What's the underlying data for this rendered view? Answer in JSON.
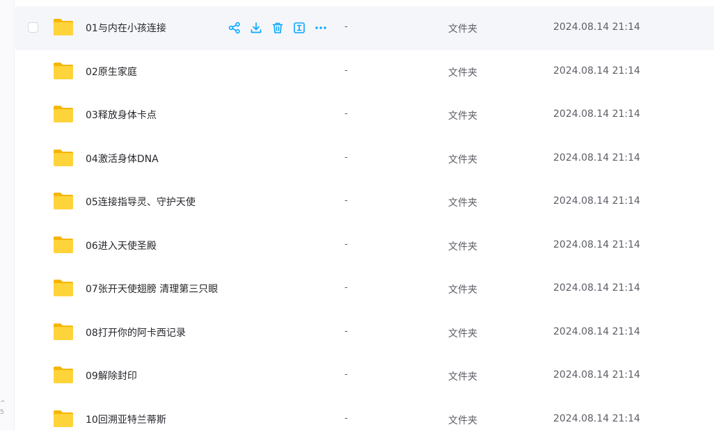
{
  "edge_marks": [
    "^",
    "5"
  ],
  "actions": [
    {
      "icon": "share-icon"
    },
    {
      "icon": "download-icon"
    },
    {
      "icon": "delete-icon"
    },
    {
      "icon": "rename-icon"
    },
    {
      "icon": "more-icon"
    }
  ],
  "colors": {
    "accent": "#06a7ff",
    "folder": "#ffd43b",
    "hover_bg": "#f5f6fa"
  },
  "files": [
    {
      "name": "01与内在小孩连接",
      "size": "-",
      "type": "文件夹",
      "date": "2024.08.14 21:14",
      "hovered": true
    },
    {
      "name": "02原生家庭",
      "size": "-",
      "type": "文件夹",
      "date": "2024.08.14 21:14"
    },
    {
      "name": "03释放身体卡点",
      "size": "-",
      "type": "文件夹",
      "date": "2024.08.14 21:14"
    },
    {
      "name": "04激活身体DNA",
      "size": "-",
      "type": "文件夹",
      "date": "2024.08.14 21:14"
    },
    {
      "name": "05连接指导灵、守护天使",
      "size": "-",
      "type": "文件夹",
      "date": "2024.08.14 21:14"
    },
    {
      "name": "06进入天使圣殿",
      "size": "-",
      "type": "文件夹",
      "date": "2024.08.14 21:14"
    },
    {
      "name": "07张开天使翅膀 清理第三只眼",
      "size": "-",
      "type": "文件夹",
      "date": "2024.08.14 21:14"
    },
    {
      "name": "08打开你的阿卡西记录",
      "size": "-",
      "type": "文件夹",
      "date": "2024.08.14 21:14"
    },
    {
      "name": "09解除封印",
      "size": "-",
      "type": "文件夹",
      "date": "2024.08.14 21:14"
    },
    {
      "name": "10回溯亚特兰蒂斯",
      "size": "-",
      "type": "文件夹",
      "date": "2024.08.14 21:14"
    }
  ]
}
